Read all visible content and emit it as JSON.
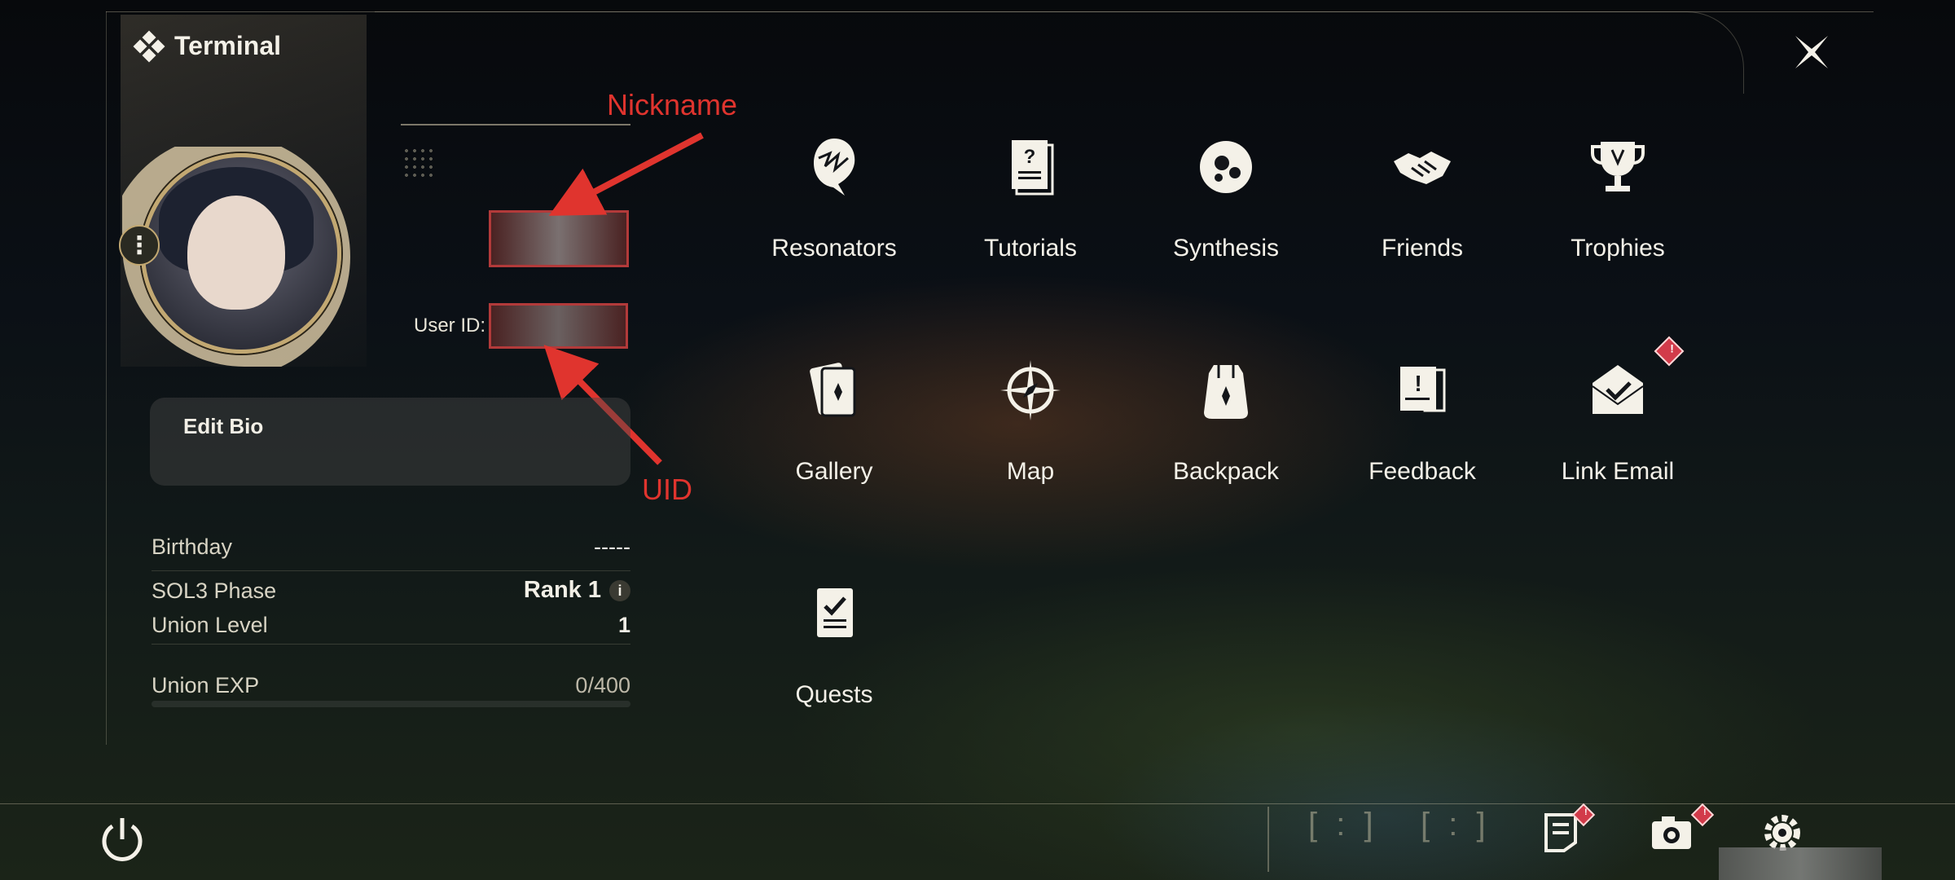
{
  "header": {
    "title": "Terminal"
  },
  "profile": {
    "uid_label": "User ID:",
    "bio_label": "Edit Bio",
    "stats": [
      {
        "label": "Birthday",
        "value": "-----"
      },
      {
        "label": "SOL3 Phase",
        "value": "Rank 1"
      },
      {
        "label": "Union Level",
        "value": "1"
      },
      {
        "label": "Union EXP",
        "value": "0/400"
      }
    ],
    "union_exp_fraction": 0
  },
  "annotations": {
    "nickname": "Nickname",
    "uid": "UID"
  },
  "menu": [
    {
      "label": "Resonators",
      "icon": "resonator-icon"
    },
    {
      "label": "Tutorials",
      "icon": "tutorial-book-icon"
    },
    {
      "label": "Synthesis",
      "icon": "synthesis-icon"
    },
    {
      "label": "Friends",
      "icon": "handshake-icon"
    },
    {
      "label": "Trophies",
      "icon": "trophy-icon"
    },
    {
      "label": "Gallery",
      "icon": "cards-icon"
    },
    {
      "label": "Map",
      "icon": "compass-icon"
    },
    {
      "label": "Backpack",
      "icon": "backpack-icon"
    },
    {
      "label": "Feedback",
      "icon": "feedback-icon"
    },
    {
      "label": "Link Email",
      "icon": "email-icon",
      "badge": "!"
    },
    {
      "label": "Quests",
      "icon": "quest-icon"
    }
  ],
  "bottom_bar": {
    "brackets": [
      "[ : ]",
      "[ : ]"
    ],
    "icons": [
      "notes-icon",
      "camera-icon",
      "settings-icon"
    ],
    "badges": [
      "!",
      "!"
    ]
  },
  "colors": {
    "accent": "#c2a872",
    "badge": "#d23b4a",
    "annotation": "#e0342e"
  }
}
